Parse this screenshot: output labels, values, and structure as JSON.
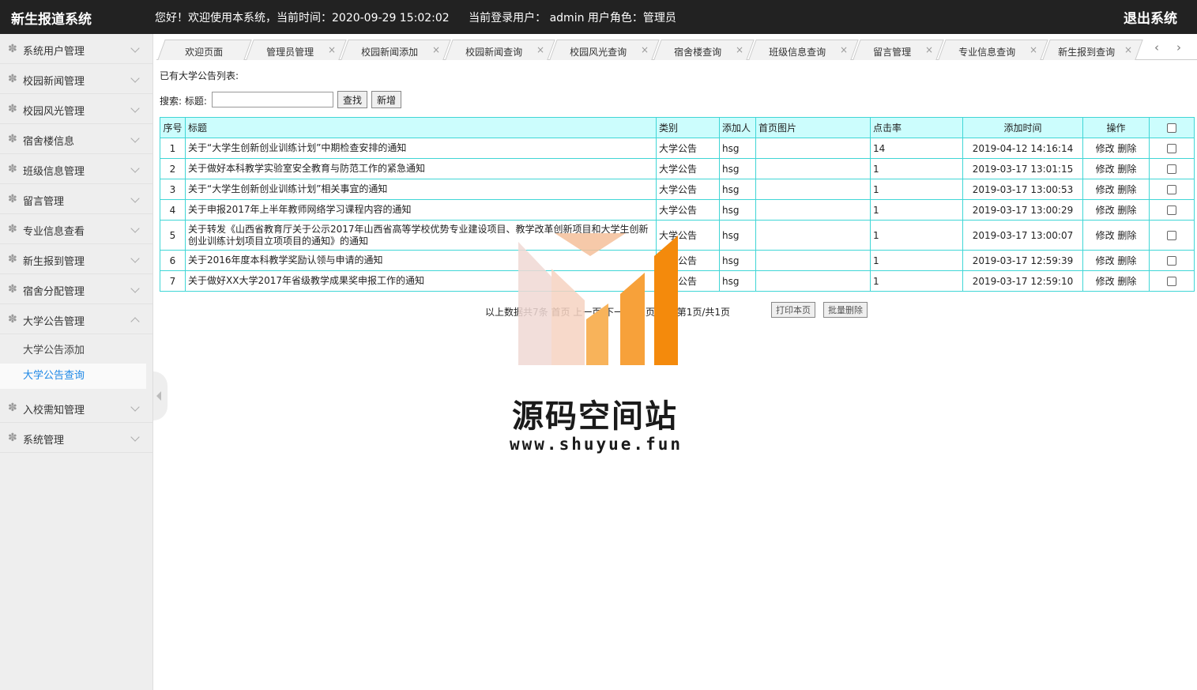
{
  "header": {
    "brand": "新生报道系统",
    "welcome": "您好！欢迎使用本系统，当前时间：2020-09-29 15:02:02",
    "user_info": "当前登录用户： admin  用户角色：管理员",
    "logout": "退出系统"
  },
  "sidebar": {
    "items": [
      {
        "label": "系统用户管理"
      },
      {
        "label": "校园新闻管理"
      },
      {
        "label": "校园风光管理"
      },
      {
        "label": "宿舍楼信息"
      },
      {
        "label": "班级信息管理"
      },
      {
        "label": "留言管理"
      },
      {
        "label": "专业信息查看"
      },
      {
        "label": "新生报到管理"
      },
      {
        "label": "宿舍分配管理"
      },
      {
        "label": "大学公告管理"
      },
      {
        "label": "入校需知管理"
      },
      {
        "label": "系统管理"
      }
    ],
    "submenu": [
      {
        "label": "大学公告添加"
      },
      {
        "label": "大学公告查询"
      }
    ]
  },
  "tabs": [
    {
      "label": "欢迎页面",
      "close": ""
    },
    {
      "label": "管理员管理",
      "close": "×"
    },
    {
      "label": "校园新闻添加",
      "close": "×"
    },
    {
      "label": "校园新闻查询",
      "close": "×"
    },
    {
      "label": "校园风光查询",
      "close": "×"
    },
    {
      "label": "宿舍楼查询",
      "close": "×"
    },
    {
      "label": "班级信息查询",
      "close": "×"
    },
    {
      "label": "留言管理",
      "close": "×"
    },
    {
      "label": "专业信息查询",
      "close": "×"
    },
    {
      "label": "新生报到查询",
      "close": "×"
    }
  ],
  "tab_nav": {
    "prev": "‹",
    "next": "›"
  },
  "main": {
    "list_title": "已有大学公告列表:",
    "search_label": "搜索: 标题:",
    "search_value": "",
    "search_button": "查找",
    "add_button": "新增"
  },
  "table": {
    "headers": {
      "no": "序号",
      "title": "标题",
      "category": "类别",
      "author": "添加人",
      "image": "首页图片",
      "clicks": "点击率",
      "time": "添加时间",
      "ops": "操作"
    },
    "rows": [
      {
        "no": "1",
        "title": "关于“大学生创新创业训练计划”中期检查安排的通知",
        "category": "大学公告",
        "author": "hsg",
        "image": "",
        "clicks": "14",
        "time": "2019-04-12 14:16:14",
        "edit": "修改",
        "delete": "删除"
      },
      {
        "no": "2",
        "title": "关于做好本科教学实验室安全教育与防范工作的紧急通知",
        "category": "大学公告",
        "author": "hsg",
        "image": "",
        "clicks": "1",
        "time": "2019-03-17 13:01:15",
        "edit": "修改",
        "delete": "删除"
      },
      {
        "no": "3",
        "title": "关于“大学生创新创业训练计划”相关事宜的通知",
        "category": "大学公告",
        "author": "hsg",
        "image": "",
        "clicks": "1",
        "time": "2019-03-17 13:00:53",
        "edit": "修改",
        "delete": "删除"
      },
      {
        "no": "4",
        "title": "关于申报2017年上半年教师网络学习课程内容的通知",
        "category": "大学公告",
        "author": "hsg",
        "image": "",
        "clicks": "1",
        "time": "2019-03-17 13:00:29",
        "edit": "修改",
        "delete": "删除"
      },
      {
        "no": "5",
        "title": "关于转发《山西省教育厅关于公示2017年山西省高等学校优势专业建设项目、教学改革创新项目和大学生创新创业训练计划项目立项项目的通知》的通知",
        "category": "大学公告",
        "author": "hsg",
        "image": "",
        "clicks": "1",
        "time": "2019-03-17 13:00:07",
        "edit": "修改",
        "delete": "删除"
      },
      {
        "no": "6",
        "title": "关于2016年度本科教学奖励认领与申请的通知",
        "category": "大学公告",
        "author": "hsg",
        "image": "",
        "clicks": "1",
        "time": "2019-03-17 12:59:39",
        "edit": "修改",
        "delete": "删除"
      },
      {
        "no": "7",
        "title": "关于做好XX大学2017年省级教学成果奖申报工作的通知",
        "category": "大学公告",
        "author": "hsg",
        "image": "",
        "clicks": "1",
        "time": "2019-03-17 12:59:10",
        "edit": "修改",
        "delete": "删除"
      }
    ]
  },
  "pager": {
    "text": "以上数据共7条 首页 上一页 下一页 尾页 当前第1页/共1页",
    "print_button": "打印本页",
    "batch_delete_button": "批量删除"
  },
  "watermark": {
    "title": "源码空间站",
    "url": "www.shuyue.fun"
  },
  "colors": {
    "topbar": "#222222",
    "table_border": "#40d6d6",
    "table_header": "#ccfdfd",
    "active_link": "#1e88e5"
  }
}
